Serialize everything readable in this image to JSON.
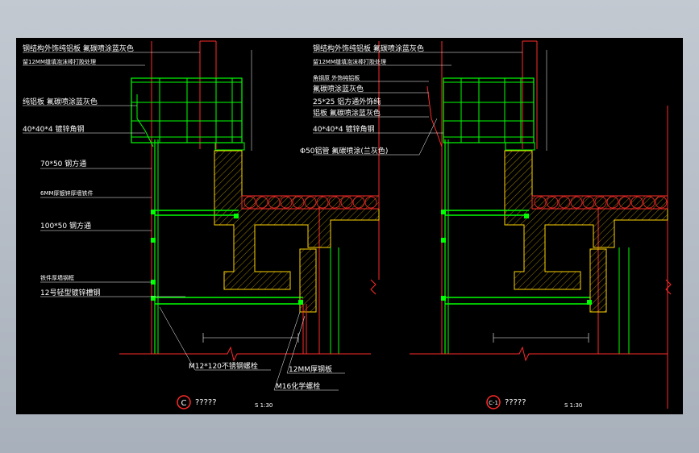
{
  "colors": {
    "background": "#000000",
    "green": "#00ff00",
    "red": "#ff2a2a",
    "yellow": "#ffd400",
    "white": "#ffffff"
  },
  "detail_left": {
    "labels": [
      "钢结构外饰纯铝板 氟碳喷涂蓝灰色",
      "留12MM缝填泡沫棒打胶处理",
      "纯铝板 氟碳喷涂蓝灰色",
      "40*40*4 镀锌角钢",
      "70*50 钢方通",
      "6MM厚镀锌厚墙铁件",
      "100*50 钢方通",
      "铁件厚墙钢框",
      "12号轻型镀锌槽钢"
    ],
    "bottom_labels": [
      "M12*120不锈钢螺栓",
      "12MM厚钢板",
      "M16化学螺栓"
    ],
    "marker": "C",
    "title": "?????",
    "scale": "S 1:30"
  },
  "detail_right": {
    "labels": [
      "钢结构外饰纯铝板 氟碳喷涂蓝灰色",
      "留12MM缝填泡沫棒打胶处理",
      "角钢原 外饰纯铝板",
      "氟碳喷涂蓝灰色",
      "25*25 铝方通外饰纯",
      "铝板 氟碳喷涂蓝灰色",
      "40*40*4 镀锌角钢",
      "Φ50铝管 氟碳喷涂(兰灰色)"
    ],
    "marker": "C-1",
    "title": "?????",
    "scale": "S 1:30"
  }
}
